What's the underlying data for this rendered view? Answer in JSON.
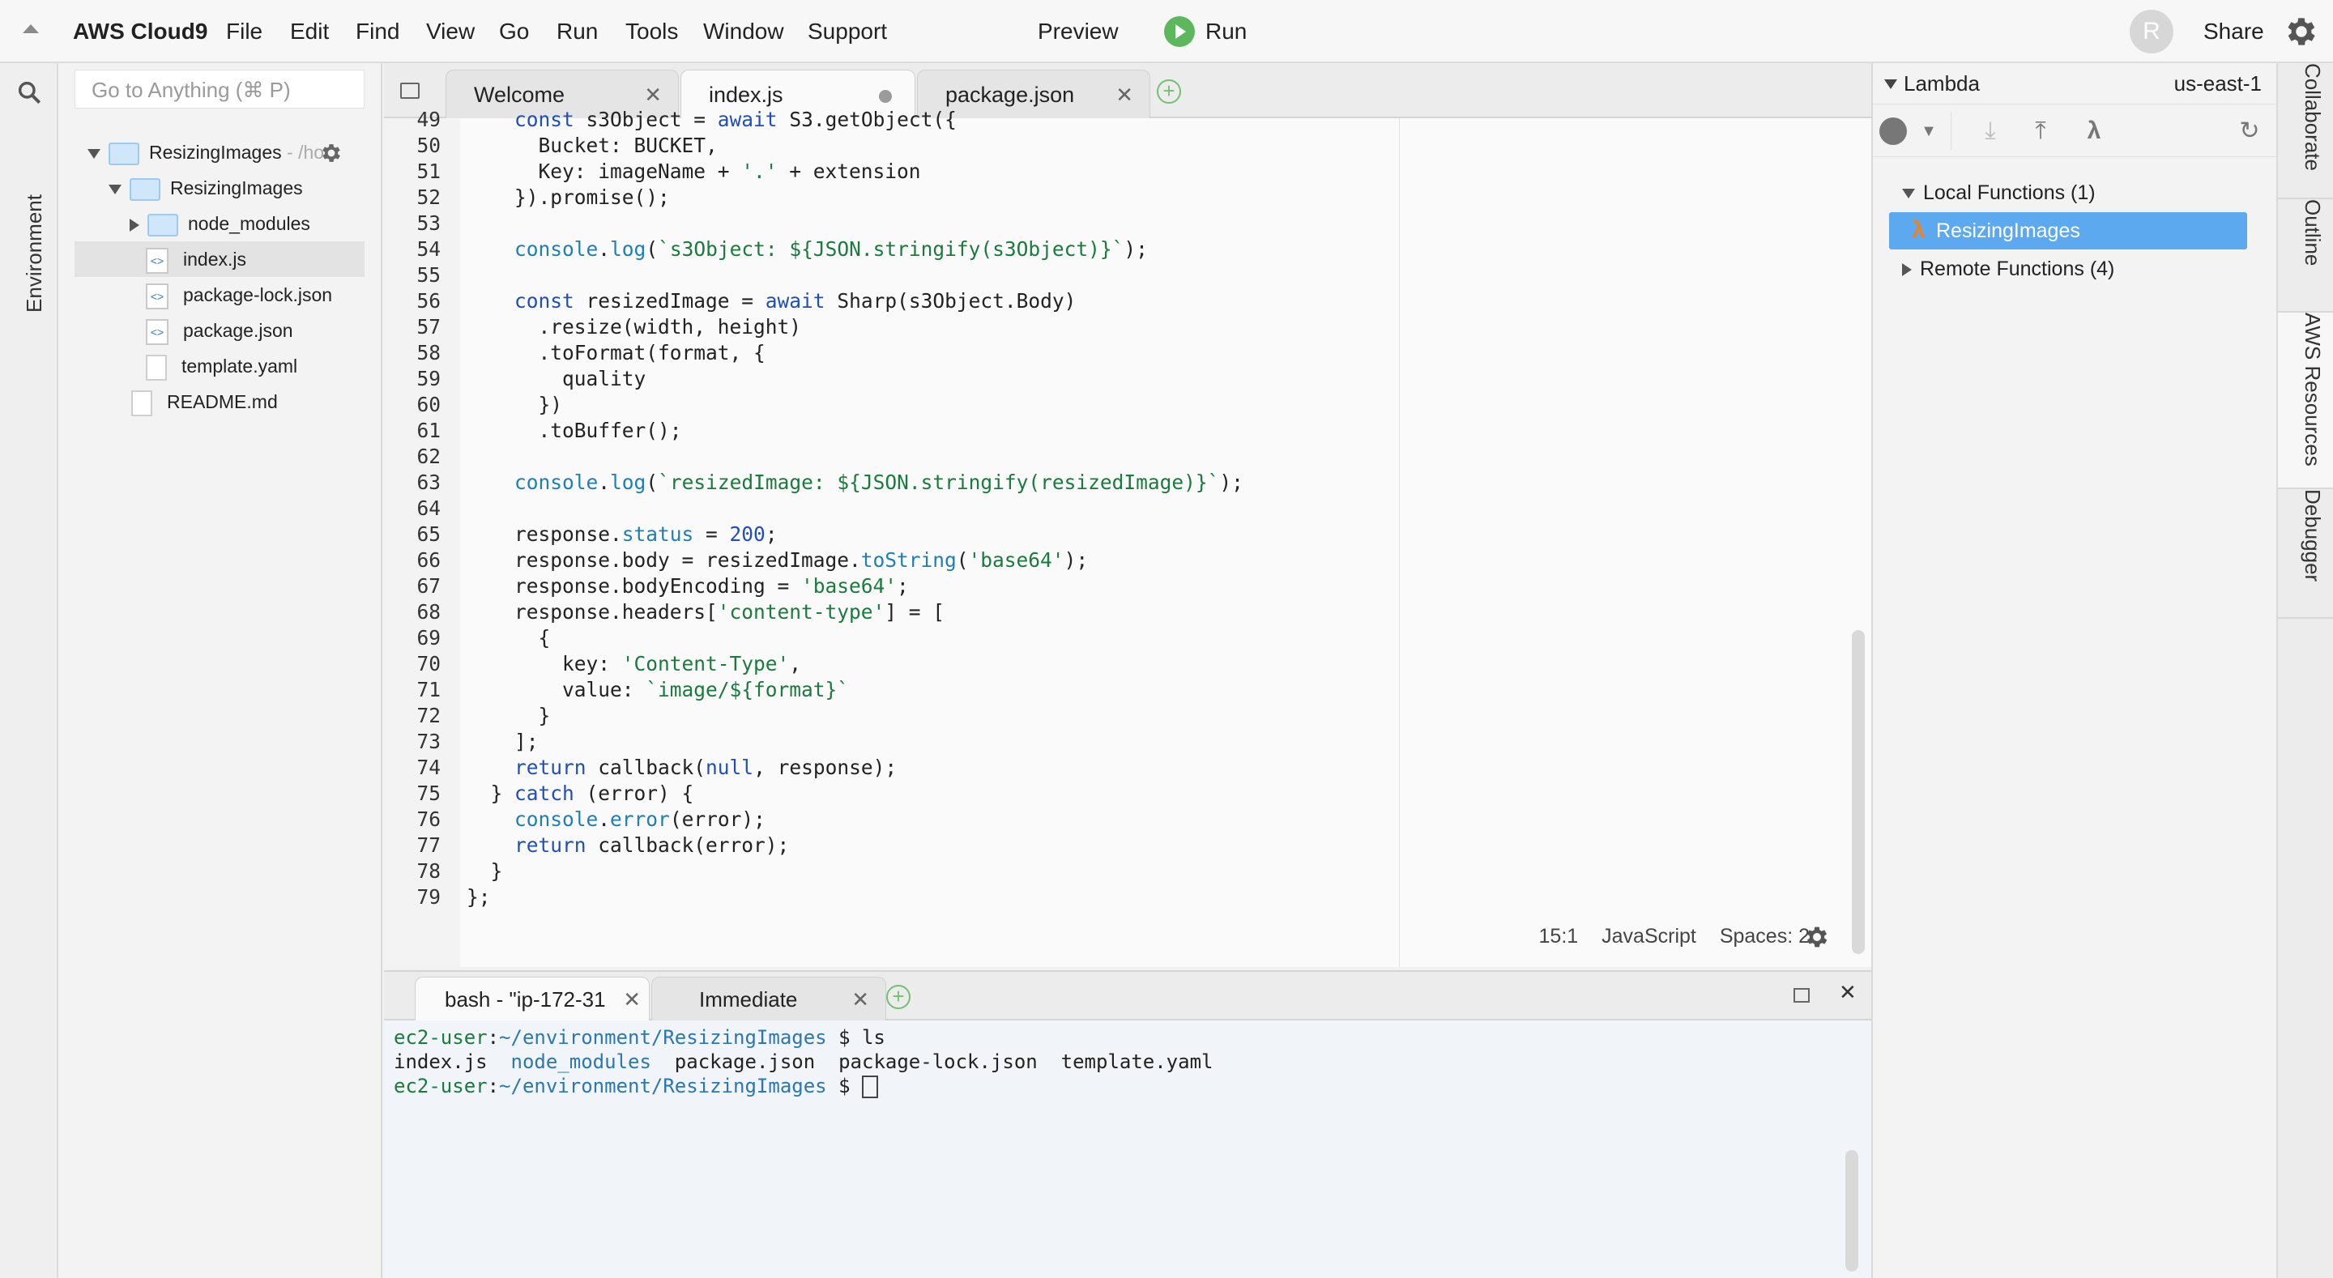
{
  "menubar": {
    "brand": "AWS Cloud9",
    "items": [
      "File",
      "Edit",
      "Find",
      "View",
      "Go",
      "Run",
      "Tools",
      "Window",
      "Support"
    ],
    "preview": "Preview",
    "run": "Run",
    "avatar_initial": "R",
    "share": "Share",
    "icons": [
      "collapse-up-icon",
      "run-play-icon",
      "settings-gear-icon"
    ]
  },
  "left_strip": {
    "environment_tab": "Environment",
    "search_icon": "search-icon"
  },
  "tree": {
    "goto_placeholder": "Go to Anything (⌘ P)",
    "root": {
      "label": "ResizingImages",
      "suffix": " - /hor"
    },
    "items": [
      {
        "label": "ResizingImages",
        "kind": "folder",
        "expanded": true
      },
      {
        "label": "node_modules",
        "kind": "folder",
        "expanded": false
      },
      {
        "label": "index.js",
        "kind": "js",
        "selected": true
      },
      {
        "label": "package-lock.json",
        "kind": "js"
      },
      {
        "label": "package.json",
        "kind": "js"
      },
      {
        "label": "template.yaml",
        "kind": "doc"
      },
      {
        "label": "README.md",
        "kind": "doc"
      }
    ]
  },
  "editor_tabs": [
    {
      "label": "Welcome",
      "state": "close"
    },
    {
      "label": "index.js",
      "state": "modified",
      "active": true
    },
    {
      "label": "package.json",
      "state": "close"
    }
  ],
  "code": {
    "first_line": 49,
    "lines": [
      "    const s3Object = await S3.getObject({",
      "      Bucket: BUCKET,",
      "      Key: imageName + '.' + extension",
      "    }).promise();",
      "",
      "    console.log(`s3Object: ${JSON.stringify(s3Object)}`);",
      "",
      "    const resizedImage = await Sharp(s3Object.Body)",
      "      .resize(width, height)",
      "      .toFormat(format, {",
      "        quality",
      "      })",
      "      .toBuffer();",
      "",
      "    console.log(`resizedImage: ${JSON.stringify(resizedImage)}`);",
      "",
      "    response.status = 200;",
      "    response.body = resizedImage.toString('base64');",
      "    response.bodyEncoding = 'base64';",
      "    response.headers['content-type'] = [",
      "      {",
      "        key: 'Content-Type',",
      "        value: `image/${format}`",
      "      }",
      "    ];",
      "    return callback(null, response);",
      "  } catch (error) {",
      "    console.error(error);",
      "    return callback(error);",
      "  }",
      "};"
    ]
  },
  "status": {
    "position": "15:1",
    "language": "JavaScript",
    "spaces": "Spaces: 2"
  },
  "terminal_tabs": [
    {
      "label": "bash - \"ip-172-31",
      "active": true
    },
    {
      "label": "Immediate",
      "active": false
    }
  ],
  "terminal": {
    "lines": [
      {
        "user": "ec2-user",
        "path": "~/environment/ResizingImages",
        "cmd": "$ ls"
      },
      {
        "output": [
          "index.js",
          "node_modules",
          "package.json",
          "package-lock.json",
          "template.yaml"
        ]
      },
      {
        "user": "ec2-user",
        "path": "~/environment/ResizingImages",
        "cmd": "$ "
      }
    ]
  },
  "lambda": {
    "title": "Lambda",
    "region": "us-east-1",
    "local_functions": "Local Functions (1)",
    "selected_function": "ResizingImages",
    "remote_functions": "Remote Functions (4)",
    "toolbar_icons": [
      "run-icon",
      "dropdown-icon",
      "import-icon",
      "deploy-icon",
      "lambda-create-icon",
      "refresh-icon"
    ]
  },
  "right_tabs": [
    "Collaborate",
    "Outline",
    "AWS Resources",
    "Debugger"
  ],
  "colors": {
    "run_green": "#5cb85c",
    "selection_blue": "#5da9ef",
    "lambda_orange": "#e8832a",
    "keyword_blue": "#1f4ebd",
    "string_green": "#1b7a3d"
  }
}
